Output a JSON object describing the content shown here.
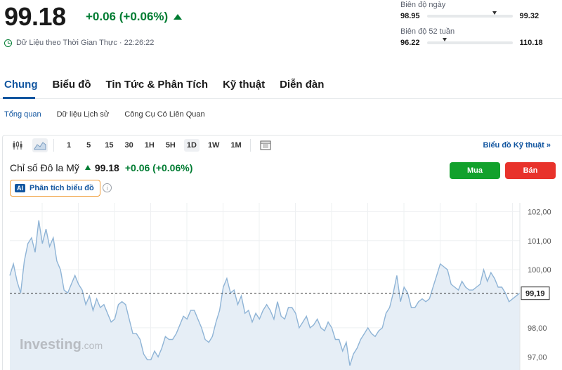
{
  "quote": {
    "price": "99.18",
    "change": "+0.06 (+0.06%)",
    "realtime_label": "Dữ Liệu theo Thời Gian Thực · 22:26:22"
  },
  "day_range": {
    "label": "Biên độ ngày",
    "low": "98.95",
    "high": "99.32",
    "position": 0.79
  },
  "week52_range": {
    "label": "Biên độ 52 tuần",
    "low": "96.22",
    "high": "110.18",
    "position": 0.21
  },
  "tabs": [
    "Chung",
    "Biểu đồ",
    "Tin Tức & Phân Tích",
    "Kỹ thuật",
    "Diễn đàn"
  ],
  "subtabs": [
    "Tổng quan",
    "Dữ liệu Lịch sử",
    "Công Cụ Có Liên Quan"
  ],
  "toolbar": {
    "timeframes": [
      "1",
      "5",
      "15",
      "30",
      "1H",
      "5H",
      "1D",
      "1W",
      "1M"
    ],
    "selected_timeframe": "1D",
    "tech_chart_link": "Biểu đồ Kỹ thuật »"
  },
  "instrument": {
    "name": "Chỉ số Đô la Mỹ",
    "value": "99.18",
    "change": "+0.06 (+0.06%)"
  },
  "buttons": {
    "buy": "Mua",
    "sell": "Bán"
  },
  "ai": {
    "badge": "AI",
    "label": "Phân tích biểu đồ",
    "info": "i"
  },
  "watermark": {
    "brand": "Investing",
    "suffix": ".com"
  },
  "colors": {
    "up": "#007c32",
    "accent": "#1256a0",
    "buy": "#12a12c",
    "sell": "#e8322b",
    "line": "#8fb4d6",
    "fill": "#e6eef6"
  },
  "chart_data": {
    "type": "area",
    "y_ticks": [
      "102,00",
      "101,00",
      "100,00",
      "99,19",
      "98,00",
      "97,00"
    ],
    "ylim": [
      96.5,
      102.3
    ],
    "last_value_label": "99,19",
    "last_value": 99.19,
    "grid": true,
    "values": [
      99.8,
      100.2,
      99.6,
      99.2,
      100.3,
      100.9,
      101.1,
      100.6,
      101.7,
      100.9,
      101.4,
      100.8,
      101.1,
      100.3,
      100.0,
      99.3,
      99.2,
      99.5,
      99.8,
      99.5,
      99.3,
      98.8,
      99.1,
      98.6,
      99.0,
      98.7,
      98.8,
      98.5,
      98.2,
      98.3,
      98.8,
      98.9,
      98.8,
      98.3,
      97.8,
      97.8,
      97.6,
      97.1,
      96.9,
      96.9,
      97.2,
      97.0,
      97.3,
      97.7,
      97.6,
      97.6,
      97.8,
      98.1,
      98.4,
      98.3,
      98.6,
      98.6,
      98.3,
      98.0,
      97.6,
      97.5,
      97.7,
      98.2,
      98.6,
      99.4,
      99.7,
      99.2,
      99.3,
      98.8,
      99.1,
      98.5,
      98.6,
      98.2,
      98.5,
      98.3,
      98.6,
      98.8,
      98.6,
      98.3,
      98.9,
      98.4,
      98.3,
      98.7,
      98.7,
      98.5,
      98.0,
      98.2,
      98.4,
      98.0,
      98.1,
      98.3,
      98.0,
      97.9,
      98.2,
      98.0,
      97.6,
      97.6,
      97.2,
      97.5,
      96.7,
      97.1,
      97.3,
      97.6,
      97.8,
      98.0,
      97.8,
      97.7,
      97.9,
      98.0,
      98.5,
      98.7,
      99.2,
      99.8,
      98.9,
      99.4,
      99.2,
      98.7,
      98.7,
      98.9,
      99.0,
      98.9,
      99.0,
      99.4,
      99.8,
      100.2,
      100.1,
      100.0,
      99.5,
      99.4,
      99.3,
      99.6,
      99.4,
      99.3,
      99.3,
      99.4,
      99.5,
      100.0,
      99.6,
      99.9,
      99.7,
      99.4,
      99.4,
      99.2,
      98.9,
      99.0,
      99.1,
      99.2
    ]
  }
}
